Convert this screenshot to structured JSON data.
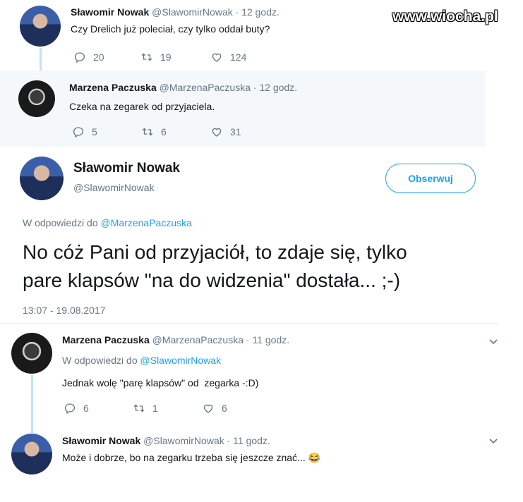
{
  "watermark": "www.wiocha.pl",
  "tweet1": {
    "name": "Sławomir Nowak",
    "handle": "@SlawomirNowak",
    "time": "· 12 godz.",
    "text": "Czy Drelich już poleciał, czy tylko oddał buty?",
    "replies": "20",
    "retweets": "19",
    "likes": "124"
  },
  "tweet2": {
    "name": "Marzena Paczuska",
    "handle": "@MarzenaPaczuska",
    "time": "· 12 godz.",
    "text": "Czeka na zegarek od przyjaciela.",
    "replies": "5",
    "retweets": "6",
    "likes": "31"
  },
  "main": {
    "name": "Sławomir Nowak",
    "handle": "@SlawomirNowak",
    "follow_label": "Obserwuj",
    "reply_to_prefix": "W odpowiedzi do",
    "reply_to_handle": "@MarzenaPaczuska",
    "text_line1": "No cóż Pani od przyjaciół, to zdaje się, tylko",
    "text_line2": "pare klapsów \"na do widzenia\" dostała... ;-)",
    "timestamp": "13:07 - 19.08.2017"
  },
  "reply1": {
    "name": "Marzena Paczuska",
    "handle": "@MarzenaPaczuska",
    "time": "· 11 godz.",
    "reply_to_prefix": "W odpowiedzi do",
    "reply_to_handle": "@SlawomirNowak",
    "text": "Jednak wolę \"parę klapsów\" od  zegarka -:D)",
    "replies": "6",
    "retweets": "1",
    "likes": "6"
  },
  "reply2": {
    "name": "Sławomir Nowak",
    "handle": "@SlawomirNowak",
    "time": "· 11 godz.",
    "text": "Może i dobrze, bo na zegarku trzeba się jeszcze znać...",
    "emoji": "😂"
  },
  "icons": {
    "reply": "reply-icon",
    "retweet": "retweet-icon",
    "like": "heart-icon",
    "more": "chevron-down-icon"
  },
  "colors": {
    "accent": "#1da1f2",
    "secondary_text": "#657786",
    "highlight_bg": "#f5f8fa",
    "thread_line": "#bfe3f7"
  }
}
